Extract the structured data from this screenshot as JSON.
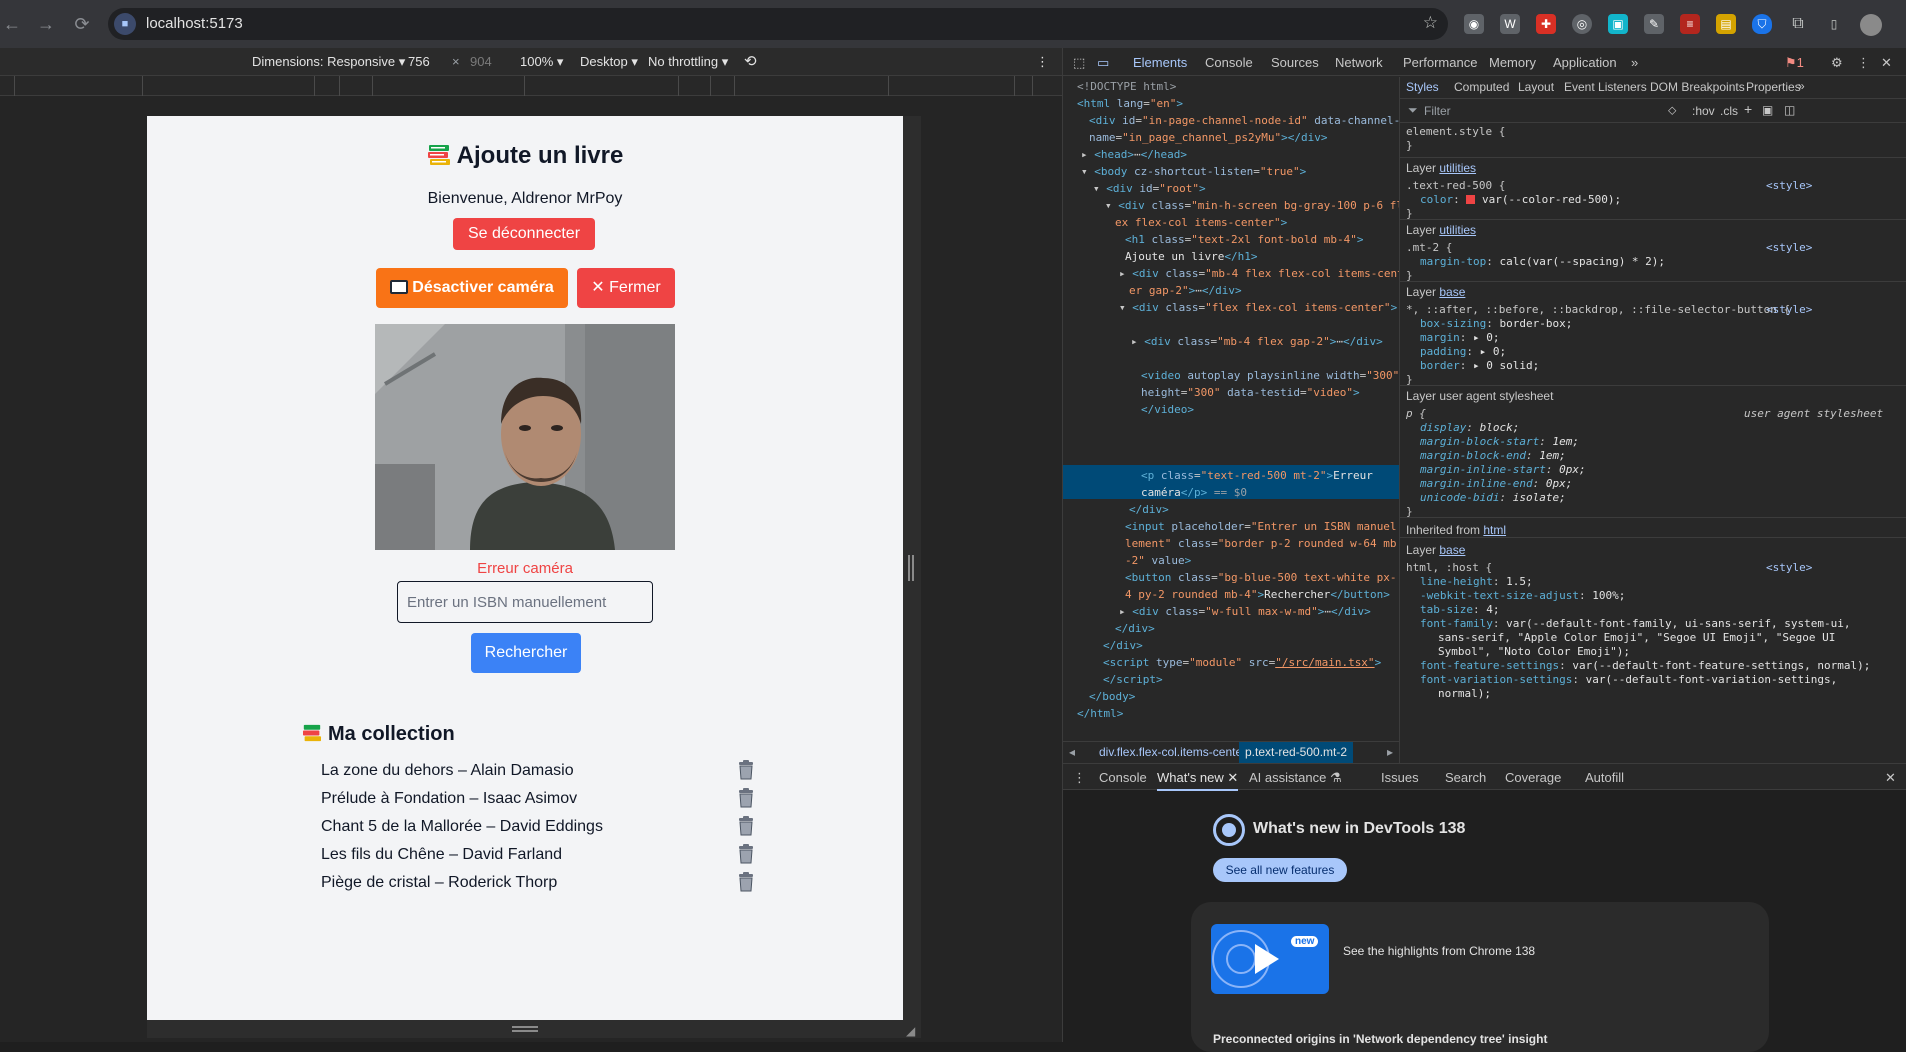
{
  "browser": {
    "url": "localhost:5173",
    "extensions": [
      "camera-icon",
      "w-icon",
      "puzzle-red-icon",
      "target-icon",
      "blue-square-icon",
      "pen-icon",
      "stack-icon",
      "yellow-icon",
      "shield-icon",
      "extensions-icon",
      "sidebar-icon",
      "avatar"
    ]
  },
  "device_toolbar": {
    "dimensions_label": "Dimensions: Responsive",
    "width": "756",
    "times": "×",
    "height": "904",
    "zoom": "100%",
    "device": "Desktop",
    "throttling": "No throttling"
  },
  "app": {
    "title": "Ajoute un livre",
    "welcome": "Bienvenue, Aldrenor MrPoy",
    "logout_label": "Se déconnecter",
    "camera_button_label": "Désactiver caméra",
    "close_button_label": "Fermer",
    "camera_error": "Erreur caméra",
    "isbn_placeholder": "Entrer un ISBN manuellement",
    "search_label": "Rechercher",
    "collection_title": "Ma collection",
    "books": [
      "La zone du dehors – Alain Damasio",
      "Prélude à Fondation – Isaac Asimov",
      "Chant 5 de la Mallorée – David Eddings",
      "Les fils du Chêne – David Farland",
      "Piège de cristal – Roderick Thorp"
    ]
  },
  "devtools": {
    "tabs": [
      "Elements",
      "Console",
      "Sources",
      "Network",
      "Performance",
      "Memory",
      "Application"
    ],
    "issues_count": "1",
    "styles_tabs": [
      "Styles",
      "Computed",
      "Layout",
      "Event Listeners",
      "DOM Breakpoints",
      "Properties"
    ],
    "filter_placeholder": "Filter",
    "hov": ":hov",
    "cls": ".cls",
    "breadcrumbs": [
      "div.flex.flex-col.items-center",
      "p.text-red-500.mt-2"
    ],
    "drawer_tabs": [
      "Console",
      "What's new",
      "AI assistance",
      "Issues",
      "Search",
      "Coverage",
      "Autofill"
    ],
    "whats_new_title": "What's new in DevTools 138",
    "see_all_label": "See all new features",
    "card_badge": "new",
    "card_text": "See the highlights from Chrome 138",
    "card2_text": "Preconnected origins in 'Network dependency tree' insight"
  }
}
